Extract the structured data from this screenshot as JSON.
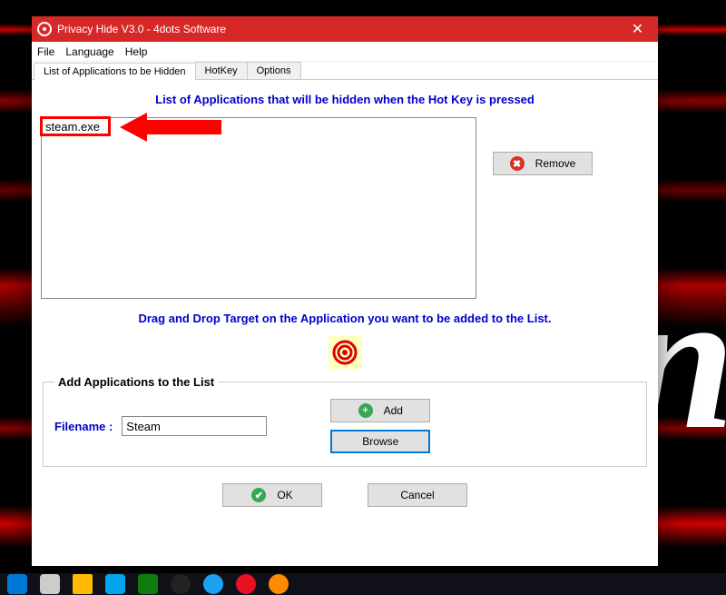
{
  "window": {
    "title": "Privacy Hide V3.0 - 4dots Software"
  },
  "menu": {
    "file": "File",
    "language": "Language",
    "help": "Help"
  },
  "tabs": {
    "list": "List of Applications to be Hidden",
    "hotkey": "HotKey",
    "options": "Options"
  },
  "headings": {
    "list_heading": "List of Applications that will be hidden when the Hot Key is pressed",
    "drag_heading": "Drag and Drop Target on the Application you want to be added to the List."
  },
  "listbox": {
    "items": [
      "steam.exe"
    ]
  },
  "buttons": {
    "remove": "Remove",
    "add": "Add",
    "browse": "Browse",
    "ok": "OK",
    "cancel": "Cancel"
  },
  "add_section": {
    "legend": "Add Applications to the List",
    "filename_label": "Filename :",
    "filename_value": "Steam"
  },
  "bg_letter": "n"
}
